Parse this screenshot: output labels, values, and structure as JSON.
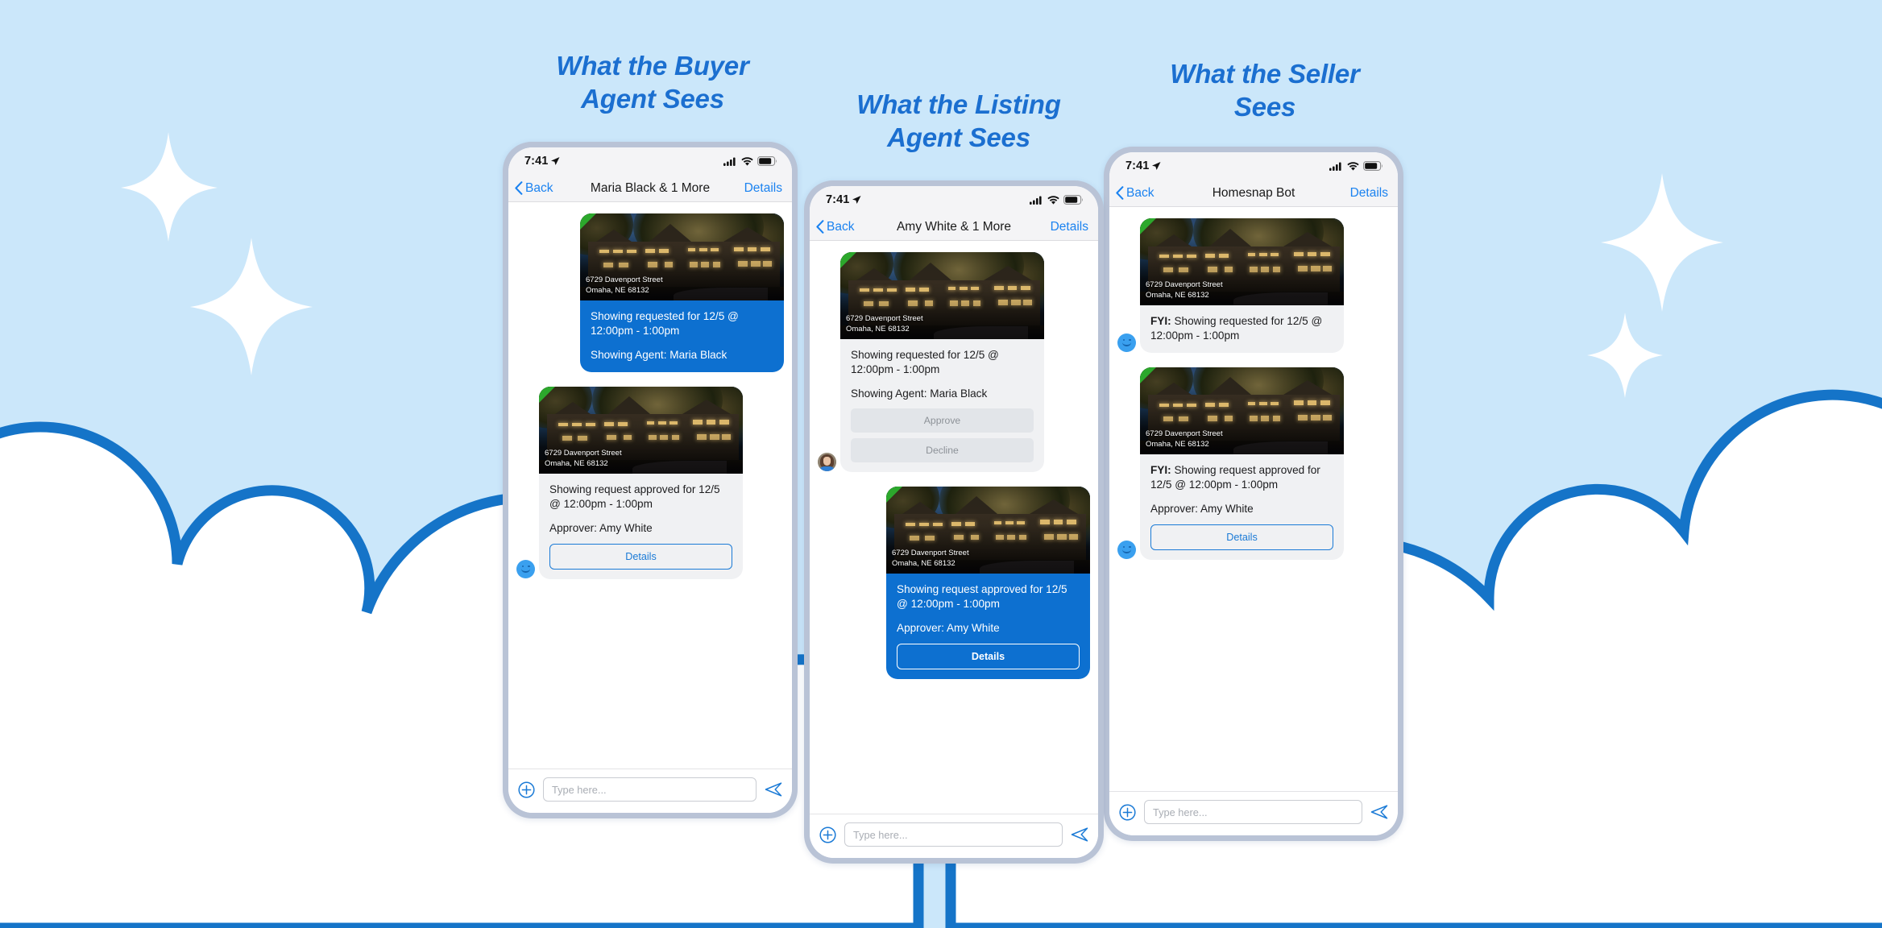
{
  "page": {
    "background_color": "#cbe7fa",
    "accent_blue": "#0d70d0",
    "cloud_outline": "#1574c8",
    "sparkle_color": "#ffffff"
  },
  "headings": {
    "buyer": "What the Buyer\nAgent Sees",
    "listing": "What the Listing\nAgent Sees",
    "seller": "What the Seller\nSees"
  },
  "status_bar": {
    "time": "7:41",
    "location_icon": "location-arrow-icon",
    "cellular_icon": "cellular-bars-icon",
    "wifi_icon": "wifi-icon",
    "battery_icon": "battery-icon"
  },
  "labels": {
    "back": "Back",
    "details": "Details",
    "approve": "Approve",
    "decline": "Decline",
    "composer_placeholder": "Type here...",
    "composer_value": "",
    "attach_icon": "plus-circle-icon",
    "send_icon": "send-paper-plane-icon",
    "back_icon": "chevron-left-icon"
  },
  "property": {
    "address_line1": "6729 Davenport Street",
    "address_line2": "Omaha, NE 68132",
    "corner_flag_color": "#2ca82c"
  },
  "phones": [
    {
      "id": "buyer",
      "nav_title": "Maria Black & 1 More",
      "messages": [
        {
          "side": "out",
          "style": "blue",
          "avatar": "none",
          "lines": [
            {
              "text": "Showing requested for 12/5 @ 12:00pm - 1:00pm"
            },
            {
              "text": "Showing Agent: Maria Black"
            }
          ],
          "buttons": []
        },
        {
          "side": "in",
          "style": "gray",
          "avatar": "smiley",
          "lines": [
            {
              "text": "Showing request approved for 12/5 @ 12:00pm - 1:00pm"
            },
            {
              "text": "Approver: Amy White"
            }
          ],
          "buttons": [
            {
              "label": "Details",
              "kind": "outline-blue"
            }
          ]
        }
      ]
    },
    {
      "id": "listing",
      "nav_title": "Amy White & 1 More",
      "messages": [
        {
          "side": "in",
          "style": "gray",
          "avatar": "photo",
          "lines": [
            {
              "text": "Showing requested for 12/5 @ 12:00pm - 1:00pm"
            },
            {
              "text": "Showing Agent: Maria Black"
            }
          ],
          "buttons": [
            {
              "label": "Approve",
              "kind": "muted"
            },
            {
              "label": "Decline",
              "kind": "muted"
            }
          ]
        },
        {
          "side": "out",
          "style": "blue",
          "avatar": "none",
          "lines": [
            {
              "text": "Showing request approved for 12/5 @ 12:00pm - 1:00pm"
            },
            {
              "text": "Approver: Amy White"
            }
          ],
          "buttons": [
            {
              "label": "Details",
              "kind": "outline-white"
            }
          ]
        }
      ]
    },
    {
      "id": "seller",
      "nav_title": "Homesnap Bot",
      "messages": [
        {
          "side": "in",
          "style": "gray",
          "avatar": "smiley",
          "lines": [
            {
              "prefix": "FYI:",
              "text": " Showing requested for 12/5 @ 12:00pm - 1:00pm"
            }
          ],
          "buttons": []
        },
        {
          "side": "in",
          "style": "gray",
          "avatar": "smiley",
          "lines": [
            {
              "prefix": "FYI:",
              "text": " Showing request approved for 12/5 @ 12:00pm - 1:00pm"
            },
            {
              "text": "Approver: Amy White"
            }
          ],
          "buttons": [
            {
              "label": "Details",
              "kind": "outline-blue"
            }
          ]
        }
      ]
    }
  ]
}
